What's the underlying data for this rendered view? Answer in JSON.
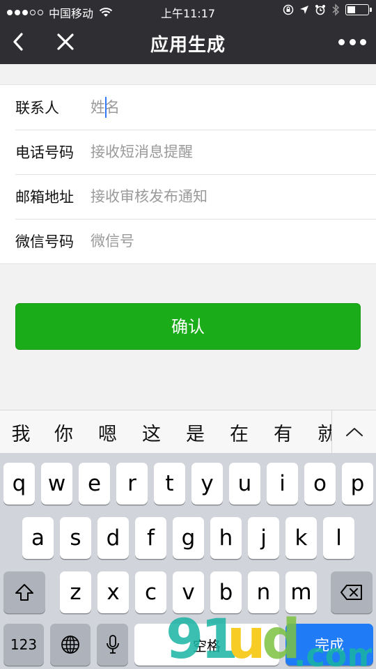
{
  "status_bar": {
    "carrier": "中国移动",
    "time": "上午11:17"
  },
  "navbar": {
    "title": "应用生成"
  },
  "form": {
    "rows": [
      {
        "label": "联系人",
        "placeholder": "姓名"
      },
      {
        "label": "电话号码",
        "placeholder": "接收短消息提醒"
      },
      {
        "label": "邮箱地址",
        "placeholder": "接收审核发布通知"
      },
      {
        "label": "微信号码",
        "placeholder": "微信号"
      }
    ]
  },
  "confirm_button": {
    "label": "确认"
  },
  "candidates": [
    "我",
    "你",
    "嗯",
    "这",
    "是",
    "在",
    "有",
    "就"
  ],
  "keyboard": {
    "row1": [
      "q",
      "w",
      "e",
      "r",
      "t",
      "y",
      "u",
      "i",
      "o",
      "p"
    ],
    "row2": [
      "a",
      "s",
      "d",
      "f",
      "g",
      "h",
      "j",
      "k",
      "l"
    ],
    "row3": [
      "z",
      "x",
      "c",
      "v",
      "b",
      "n",
      "m"
    ],
    "numbers_label": "123",
    "space_label": "空格",
    "done_label": "完成"
  },
  "watermark": {
    "text": "91ud.com"
  },
  "colors": {
    "nav_bg": "#2e2e33",
    "confirm_green": "#1aad19",
    "done_blue": "#1f7cf6",
    "keyboard_bg": "#d1d4da"
  }
}
